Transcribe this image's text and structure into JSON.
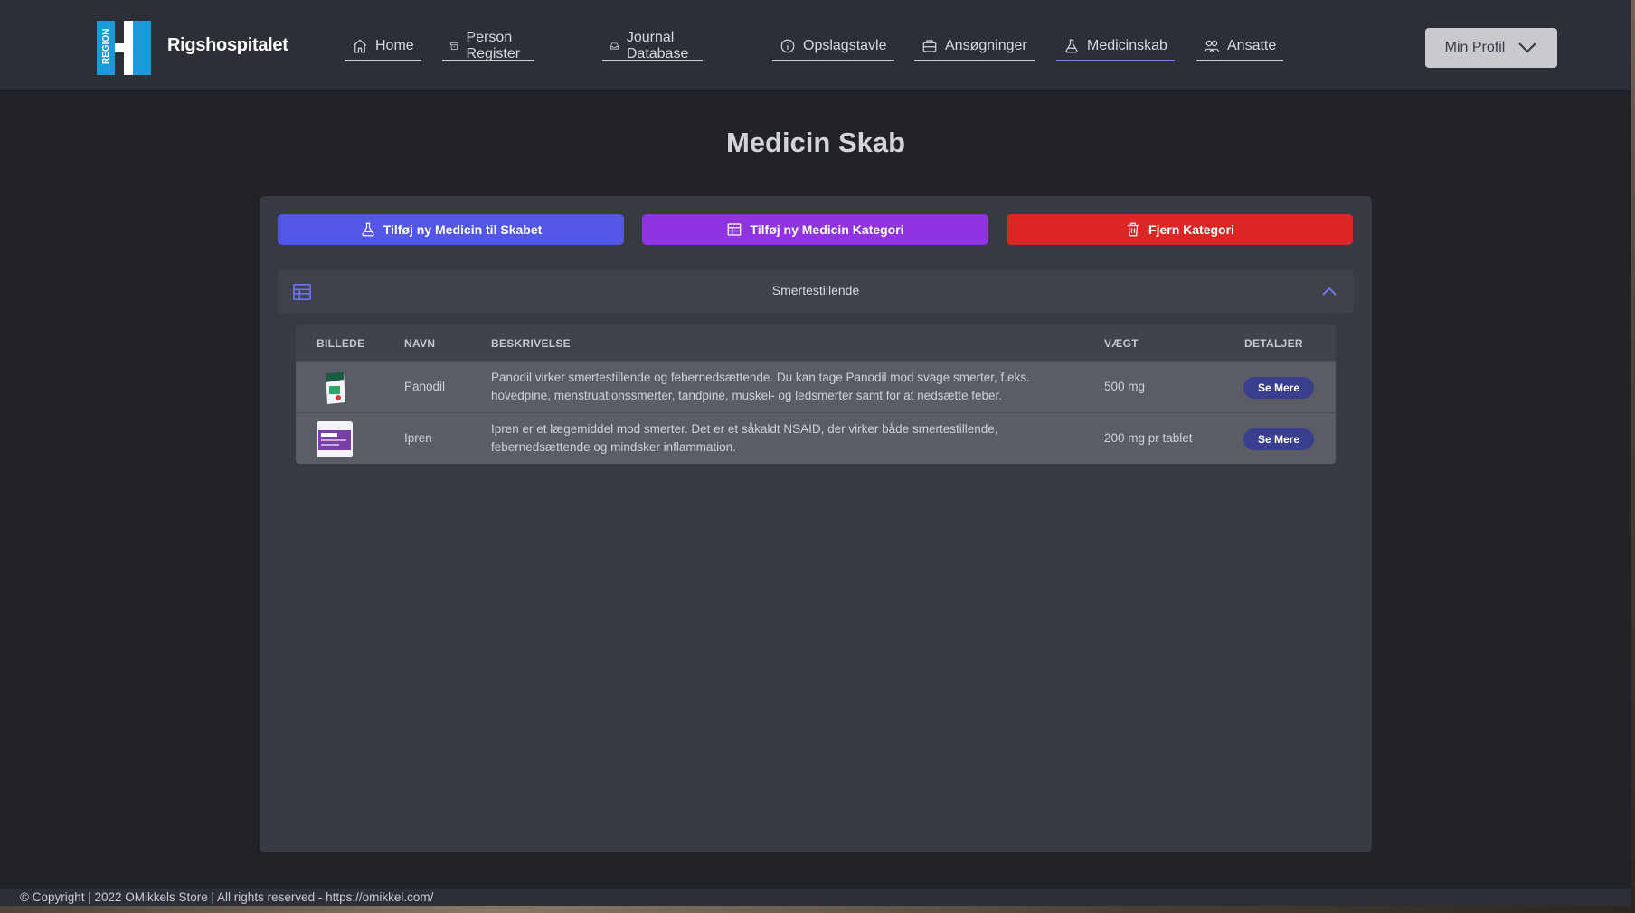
{
  "brand": {
    "logo_text": "REGION",
    "name": "Rigshospitalet"
  },
  "nav": {
    "items": [
      {
        "label": "Home",
        "icon": "home-icon"
      },
      {
        "label": "Person Register",
        "icon": "archive-icon"
      },
      {
        "label": "Journal Database",
        "icon": "inbox-icon"
      },
      {
        "label": "Opslagstavle",
        "icon": "info-icon"
      },
      {
        "label": "Ansøgninger",
        "icon": "briefcase-icon"
      },
      {
        "label": "Medicinskab",
        "icon": "flask-icon",
        "active": true
      },
      {
        "label": "Ansatte",
        "icon": "users-icon"
      }
    ]
  },
  "profile": {
    "label": "Min Profil"
  },
  "page": {
    "title": "Medicin Skab"
  },
  "actions": {
    "add_medicine": "Tilføj ny Medicin til Skabet",
    "add_category": "Tilføj ny Medicin Kategori",
    "remove_category": "Fjern Kategori"
  },
  "category": {
    "title": "Smertestillende"
  },
  "table": {
    "headers": [
      "BILLEDE",
      "NAVN",
      "BESKRIVELSE",
      "VÆGT",
      "DETALJER"
    ],
    "rows": [
      {
        "name": "Panodil",
        "description": "Panodil virker smertestillende og febernedsættende. Du kan tage Panodil mod svage smerter, f.eks. hovedpine, menstruationssmerter, tandpine, muskel- og ledsmerter samt for at nedsætte feber.",
        "weight": "500 mg",
        "details": "Se Mere"
      },
      {
        "name": "Ipren",
        "description": "Ipren er et lægemiddel mod smerter. Det er et såkaldt NSAID, der virker både smertestillende, febernedsættende og mindsker inflammation.",
        "weight": "200 mg pr tablet",
        "details": "Se Mere"
      }
    ]
  },
  "footer": {
    "text": "© Copyright | 2022 OMikkels Store | All rights reserved - https://omikkel.com/"
  },
  "colors": {
    "accent": "#5357e6",
    "purple": "#8f34e0",
    "danger": "#dc2626",
    "logo_blue": "#1a9ad9"
  }
}
